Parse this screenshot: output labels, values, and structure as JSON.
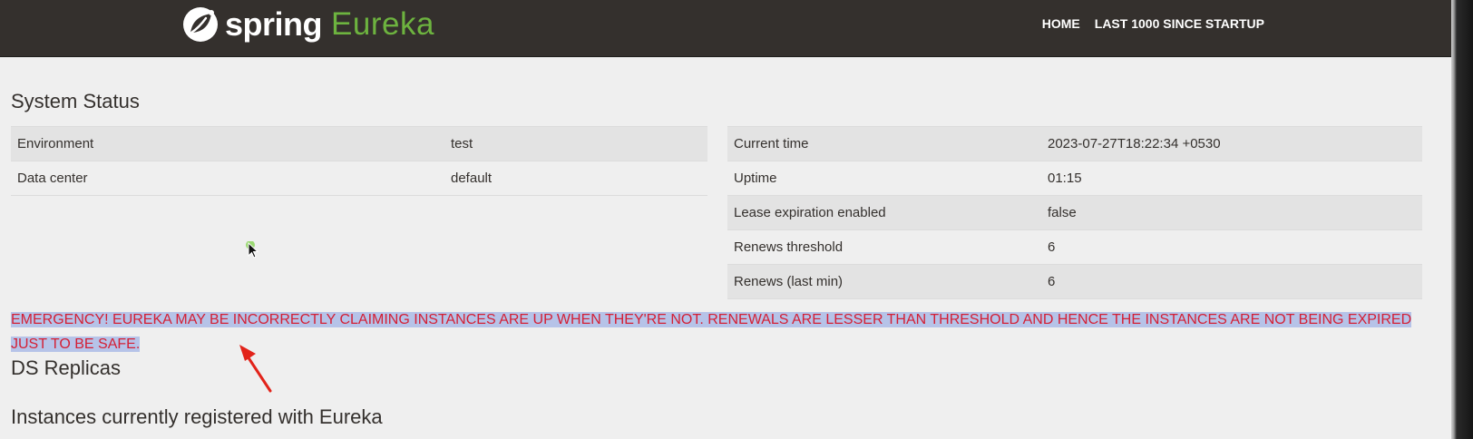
{
  "navbar": {
    "brand_spring": "spring",
    "brand_eureka": "Eureka",
    "links": [
      {
        "label": "HOME"
      },
      {
        "label": "LAST 1000 SINCE STARTUP"
      }
    ]
  },
  "system_status": {
    "title": "System Status",
    "left_rows": [
      {
        "label": "Environment",
        "value": "test"
      },
      {
        "label": "Data center",
        "value": "default"
      }
    ],
    "right_rows": [
      {
        "label": "Current time",
        "value": "2023-07-27T18:22:34 +0530"
      },
      {
        "label": "Uptime",
        "value": "01:15"
      },
      {
        "label": "Lease expiration enabled",
        "value": "false"
      },
      {
        "label": "Renews threshold",
        "value": "6"
      },
      {
        "label": "Renews (last min)",
        "value": "6"
      }
    ]
  },
  "warning": {
    "text": "EMERGENCY! EUREKA MAY BE INCORRECTLY CLAIMING INSTANCES ARE UP WHEN THEY'RE NOT. RENEWALS ARE LESSER THAN THRESHOLD AND HENCE THE INSTANCES ARE NOT BEING EXPIRED JUST TO BE SAFE."
  },
  "ds_replicas": {
    "title": "DS Replicas"
  },
  "instances": {
    "title": "Instances currently registered with Eureka"
  },
  "colors": {
    "navbar_bg": "#34302d",
    "brand_green": "#6db33f",
    "warning_red": "#d41f34",
    "selection": "#b6c3e8",
    "annotation_arrow": "#e2231a"
  },
  "icons": {
    "logo": "spring-leaf-logo-icon",
    "cursor": "mouse-cursor-icon",
    "annotation": "red-arrow-annotation-icon"
  }
}
